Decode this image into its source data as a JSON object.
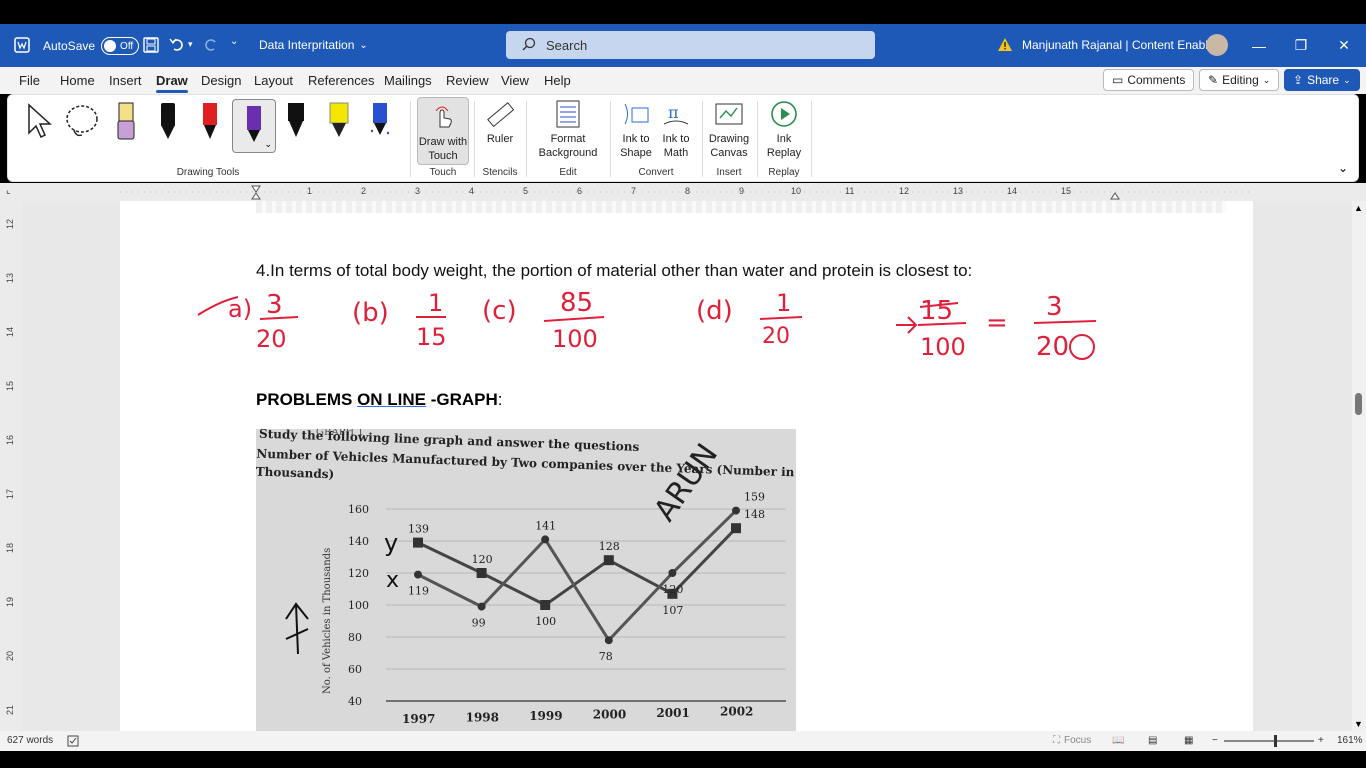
{
  "titlebar": {
    "autosave_label": "AutoSave",
    "autosave_state": "Off",
    "doc_title": "Data Interpritation",
    "search_placeholder": "Search",
    "user_name": "Manjunath Rajanal | Content Enablers"
  },
  "menu": {
    "tabs": [
      "File",
      "Home",
      "Insert",
      "Draw",
      "Design",
      "Layout",
      "References",
      "Mailings",
      "Review",
      "View",
      "Help"
    ],
    "active": "Draw",
    "comments_label": "Comments",
    "editing_label": "Editing",
    "share_label": "Share"
  },
  "ribbon": {
    "groups": {
      "drawing_tools": "Drawing Tools",
      "touch": "Touch",
      "stencils": "Stencils",
      "edit": "Edit",
      "convert": "Convert",
      "insert": "Insert",
      "replay": "Replay"
    },
    "buttons": {
      "draw_with_touch_1": "Draw with",
      "draw_with_touch_2": "Touch",
      "ruler": "Ruler",
      "format_bg_1": "Format",
      "format_bg_2": "Background",
      "ink_to_shape_1": "Ink to",
      "ink_to_shape_2": "Shape",
      "ink_to_math_1": "Ink to",
      "ink_to_math_2": "Math",
      "drawing_canvas_1": "Drawing",
      "drawing_canvas_2": "Canvas",
      "ink_replay_1": "Ink",
      "ink_replay_2": "Replay"
    },
    "pen_colors": [
      "#f5e08a",
      "#111111",
      "#e02020",
      "#6a2fb0",
      "#111111",
      "#f3e600",
      "#2a4fd0"
    ]
  },
  "ruler": {
    "top_numbers": [
      "1",
      "2",
      "3",
      "4",
      "5",
      "6",
      "7",
      "8",
      "9",
      "10",
      "11",
      "12",
      "13",
      "14",
      "15"
    ],
    "left_numbers": [
      "12",
      "13",
      "14",
      "15",
      "16",
      "17",
      "18",
      "19",
      "20",
      "21"
    ]
  },
  "document": {
    "question": "4.In terms of total body weight, the portion of material other than water and protein is closest to:",
    "heading_part1": "PROBLEMS ",
    "heading_part2": "ON LINE",
    "heading_part3": " -GRAPH",
    "heading_colon": ":",
    "ink_notes": [
      "a)",
      "3",
      "20",
      "(b)",
      "1",
      "15",
      "(c)",
      "85",
      "100",
      "(d)",
      "1",
      "20",
      "15",
      "100",
      "=",
      "3",
      "20"
    ],
    "photo": {
      "instruction_1": "Study the following line graph and answer the questions",
      "instruction_2": "Number of Vehicles Manufactured by Two companies over the Years (Number in",
      "instruction_3": "Thousands)",
      "graph_title_fragment": "GRAPH 1",
      "ylabel": "No. of Vehicles in Thousands",
      "ink_annotations": [
        "y",
        "x",
        "ARUN"
      ]
    }
  },
  "chart_data": {
    "type": "line",
    "categories": [
      "1997",
      "1998",
      "1999",
      "2000",
      "2001",
      "2002"
    ],
    "series": [
      {
        "name": "y",
        "values": [
          139,
          120,
          100,
          128,
          107,
          148
        ],
        "color": "#444444"
      },
      {
        "name": "x",
        "values": [
          119,
          99,
          141,
          78,
          120,
          159
        ],
        "color": "#555555"
      }
    ],
    "xlabel": "",
    "ylabel": "No. of Vehicles in Thousands",
    "ylim": [
      40,
      160
    ],
    "yticks": [
      "40",
      "60",
      "80",
      "100",
      "120",
      "140",
      "160"
    ]
  },
  "status": {
    "word_count": "627 words",
    "focus_label": "Focus",
    "zoom": "161%"
  }
}
